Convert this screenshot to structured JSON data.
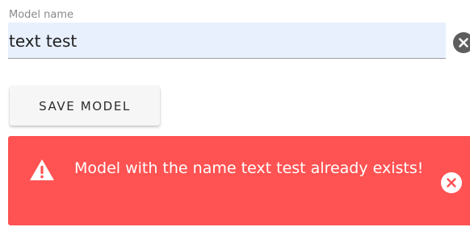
{
  "form": {
    "model_name_label": "Model name",
    "model_name_value": "text test",
    "clear_icon": "close-circle-icon",
    "save_label": "SAVE MODEL"
  },
  "alert": {
    "message": "Model with the name text test already exists!",
    "icon": "warning-triangle-icon",
    "close_icon": "close-circle-icon",
    "color": "#ff5252"
  },
  "colors": {
    "input_background": "#e8f0fe",
    "clear_button": "#5e5e5e"
  }
}
